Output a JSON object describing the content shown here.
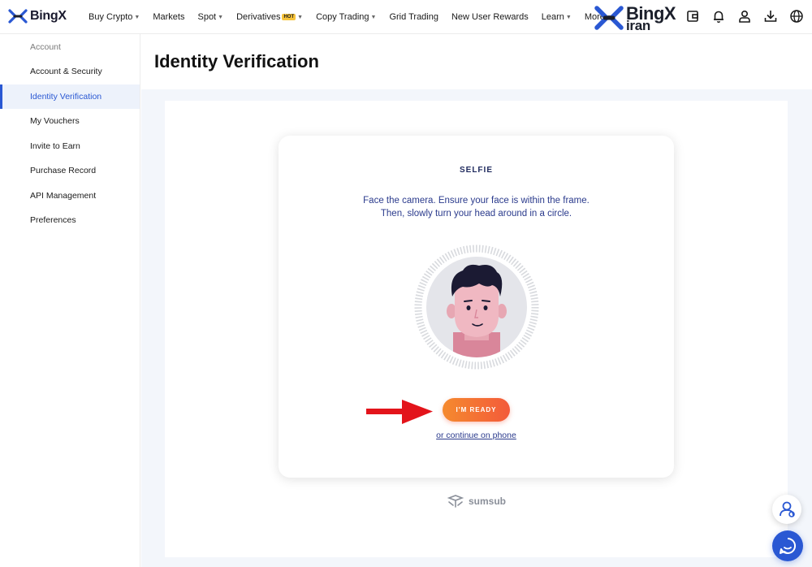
{
  "brand": {
    "name": "BingX",
    "partner_line1": "BingX",
    "partner_line2": "iran"
  },
  "nav": {
    "items": [
      {
        "label": "Buy Crypto",
        "caret": true
      },
      {
        "label": "Markets",
        "caret": false
      },
      {
        "label": "Spot",
        "caret": true
      },
      {
        "label": "Derivatives",
        "caret": true,
        "badge": "HOT"
      },
      {
        "label": "Copy Trading",
        "caret": true
      },
      {
        "label": "Grid Trading",
        "caret": false
      },
      {
        "label": "New User Rewards",
        "caret": false
      },
      {
        "label": "Learn",
        "caret": true
      },
      {
        "label": "More",
        "caret": true
      }
    ],
    "icons": [
      "wallet-icon",
      "bell-icon",
      "user-icon",
      "download-icon",
      "globe-icon"
    ]
  },
  "sidebar": {
    "heading": "Account",
    "items": [
      {
        "label": "Account & Security",
        "active": false
      },
      {
        "label": "Identity Verification",
        "active": true
      },
      {
        "label": "My Vouchers",
        "active": false
      },
      {
        "label": "Invite to Earn",
        "active": false
      },
      {
        "label": "Purchase Record",
        "active": false
      },
      {
        "label": "API Management",
        "active": false
      },
      {
        "label": "Preferences",
        "active": false
      }
    ]
  },
  "main": {
    "title": "Identity Verification",
    "card": {
      "title": "SELFIE",
      "instruction_line1": "Face the camera. Ensure your face is within the frame.",
      "instruction_line2": "Then, slowly turn your head around in a circle.",
      "ready_button": "I'M READY",
      "phone_link": "or continue on phone"
    },
    "powered_by": "sumsub"
  },
  "colors": {
    "accent": "#2a58d3",
    "button_gradient_start": "#f58a2e",
    "button_gradient_end": "#f35a3a",
    "arrow": "#e3141b",
    "text_blue": "#2a3a8c"
  }
}
